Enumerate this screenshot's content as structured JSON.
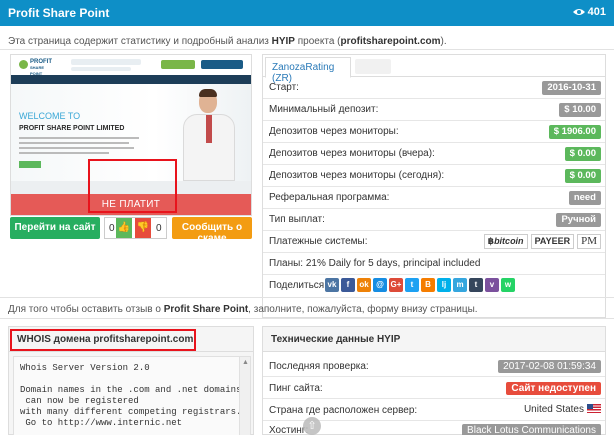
{
  "header": {
    "title": "Profit Share Point",
    "views": "401",
    "views_icon": "eye-icon"
  },
  "intro": {
    "pre": "Эта страница содержит статистику и подробный анализ ",
    "hyip": "HYIP",
    "mid": " проекта (",
    "domain": "profitsharepoint.com",
    "post": ")."
  },
  "thumbnail": {
    "logo_text_1": "PROFIT",
    "logo_text_2": "SHARE POINT",
    "welcome": "WELCOME TO",
    "company": "PROFIT SHARE POINT LIMITED",
    "status_overlay": "НЕ ПЛАТИТ"
  },
  "actions": {
    "goto_label": "Перейти на сайт",
    "votes_up": "0",
    "votes_down": "0",
    "report_label": "Сообщить о скаме"
  },
  "stats": {
    "tab_label": "ZanozaRating (ZR)",
    "rows": [
      {
        "label": "Старт:",
        "value": "2016-10-31",
        "color": "#999999"
      },
      {
        "label": "Минимальный депозит:",
        "value": "$ 10.00",
        "color": "#999999"
      },
      {
        "label": "Депозитов через мониторы:",
        "value": "$ 1906.00",
        "color": "#5cb85c"
      },
      {
        "label": "Депозитов через мониторы (вчера):",
        "value": "$ 0.00",
        "color": "#5cb85c"
      },
      {
        "label": "Депозитов через мониторы (сегодня):",
        "value": "$ 0.00",
        "color": "#5cb85c"
      },
      {
        "label": "Реферальная программа:",
        "value": "need",
        "color": "#999999"
      },
      {
        "label": "Тип выплат:",
        "value": "Ручной",
        "color": "#999999"
      }
    ],
    "payments_label": "Платежные системы:",
    "payments": [
      "bitcoin",
      "PAYEER",
      "PM"
    ],
    "plans": "Планы: 21% Daily for 5 days, principal included",
    "share_label": "Поделиться:",
    "share_icons": [
      {
        "name": "vk-icon",
        "glyph": "vk",
        "color": "#4c75a3"
      },
      {
        "name": "facebook-icon",
        "glyph": "f",
        "color": "#3b5998"
      },
      {
        "name": "odnoklassniki-icon",
        "glyph": "ok",
        "color": "#ee8208"
      },
      {
        "name": "mailru-icon",
        "glyph": "@",
        "color": "#168de2"
      },
      {
        "name": "googleplus-icon",
        "glyph": "G+",
        "color": "#dd4b39"
      },
      {
        "name": "twitter-icon",
        "glyph": "t",
        "color": "#1da1f2"
      },
      {
        "name": "blogger-icon",
        "glyph": "B",
        "color": "#f57d00"
      },
      {
        "name": "livejournal-icon",
        "glyph": "lj",
        "color": "#00b0ea"
      },
      {
        "name": "moimir-icon",
        "glyph": "m",
        "color": "#35a6de"
      },
      {
        "name": "tumblr-icon",
        "glyph": "t",
        "color": "#35465c"
      },
      {
        "name": "viber-icon",
        "glyph": "v",
        "color": "#7b519d"
      },
      {
        "name": "whatsapp-icon",
        "glyph": "w",
        "color": "#25d366"
      }
    ]
  },
  "review": {
    "pre": "Для того чтобы оставить отзыв о ",
    "name": "Profit Share Point",
    "post": ", заполните, пожалуйста, форму внизу страницы."
  },
  "whois": {
    "title": "WHOIS домена profitsharepoint.com",
    "text": "Whois Server Version 2.0\n\nDomain names in the .com and .net domains\n can now be registered\nwith many different competing registrars.\n Go to http://www.internic.net"
  },
  "tech": {
    "title": "Технические данные HYIP",
    "rows": [
      {
        "label": "Последняя проверка:",
        "value": "2017-02-08 01:59:34"
      },
      {
        "label": "Пинг сайта:",
        "value": "Сайт недоступен"
      },
      {
        "label": "Страна где расположен сервер:",
        "value": "United States"
      },
      {
        "label": "Хостинг:",
        "value": "Black Lotus Communications"
      }
    ]
  }
}
